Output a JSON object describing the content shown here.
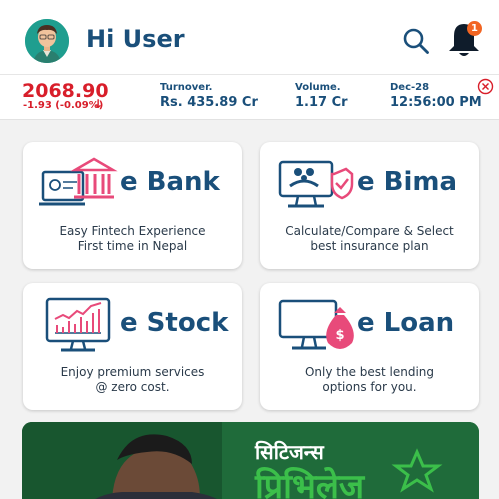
{
  "header": {
    "greeting": "Hi User",
    "notification_count": "1"
  },
  "ticker": {
    "index_value": "2068.90",
    "index_change": "-1.93 (-0.09%)",
    "change_direction_icon": "arrow-down-icon",
    "turnover_label": "Turnover.",
    "turnover_value": "Rs. 435.89 Cr",
    "volume_label": "Volume.",
    "volume_value": "1.17 Cr",
    "date_label": "Dec-28",
    "time_value": "12:56:00 PM"
  },
  "cards": [
    {
      "title": "e Bank",
      "desc_line1": "Easy Fintech Experience",
      "desc_line2": "First time in Nepal",
      "icon": "bank-icon"
    },
    {
      "title": "e Bima",
      "desc_line1": "Calculate/Compare & Select",
      "desc_line2": "best insurance plan",
      "icon": "insurance-icon"
    },
    {
      "title": "e Stock",
      "desc_line1": "Enjoy premium services",
      "desc_line2": "@ zero cost.",
      "icon": "stock-chart-icon"
    },
    {
      "title": "e Loan",
      "desc_line1": "Only the best lending",
      "desc_line2": "options for you.",
      "icon": "loan-bag-icon"
    }
  ],
  "banner": {
    "line1": "सिटिजन्स",
    "line2": "प्रिभिलेज"
  },
  "colors": {
    "brand_blue": "#1a4f7a",
    "negative": "#d81e2a",
    "accent_pink": "#e84a7a",
    "badge": "#f26522",
    "banner_green": "#1f6b3a"
  }
}
